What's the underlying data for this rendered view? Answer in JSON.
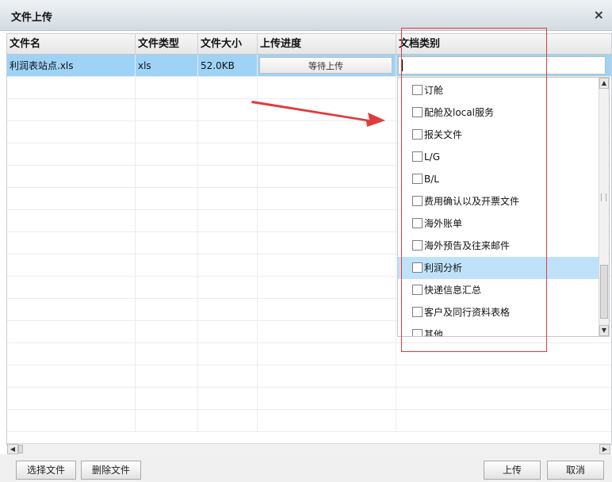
{
  "dialog": {
    "title": "文件上传",
    "close_symbol": "×"
  },
  "grid": {
    "columns": [
      "文件名",
      "文件类型",
      "文件大小",
      "上传进度",
      "文档类别"
    ],
    "rows": [
      {
        "name": "利润表站点.xls",
        "type": "xls",
        "size": "52.0KB",
        "progress": "等待上传",
        "category": ""
      }
    ]
  },
  "dropdown": {
    "options": [
      {
        "label": "订舱",
        "checked": false
      },
      {
        "label": "配舱及local服务",
        "checked": false
      },
      {
        "label": "报关文件",
        "checked": false
      },
      {
        "label": "L/G",
        "checked": false
      },
      {
        "label": "B/L",
        "checked": false
      },
      {
        "label": "费用确认以及开票文件",
        "checked": false
      },
      {
        "label": "海外账单",
        "checked": false
      },
      {
        "label": "海外预告及往来邮件",
        "checked": false
      },
      {
        "label": "利润分析",
        "checked": false
      },
      {
        "label": "快递信息汇总",
        "checked": false
      },
      {
        "label": "客户及同行资料表格",
        "checked": false
      },
      {
        "label": "其他",
        "checked": false
      }
    ],
    "highlighted_option": "利润分析"
  },
  "footer": {
    "select_file": "选择文件",
    "delete_file": "删除文件",
    "upload": "上传",
    "cancel": "取消"
  },
  "colors": {
    "selected_row": "#9ed3f6",
    "highlight_option": "#bfe2fa",
    "annotation_red": "#e23b3b"
  }
}
